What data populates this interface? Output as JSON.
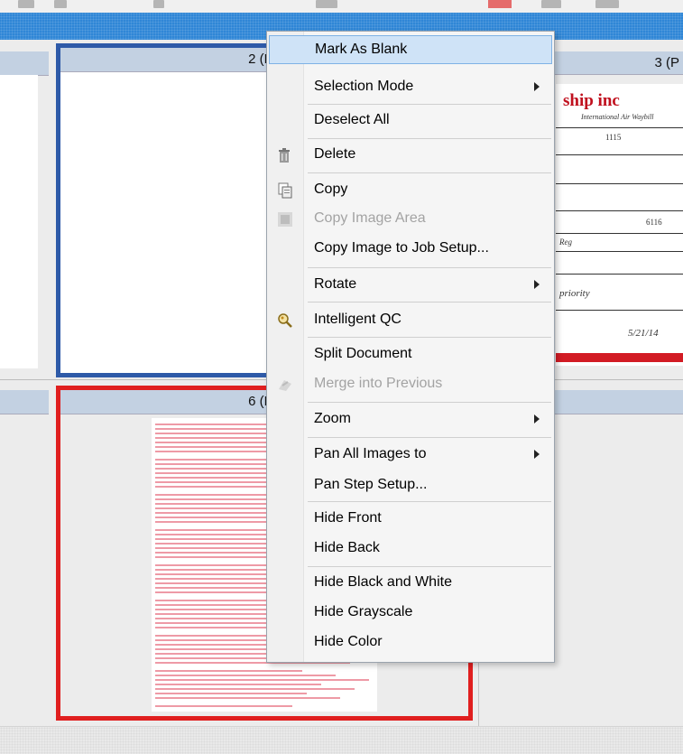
{
  "cells": {
    "page2_label": "2 (Pg",
    "page3_label": "3 (P",
    "page6_label": "6 (Pg"
  },
  "doc3": {
    "brand": "ship inc",
    "tagline": "International Air Waybill",
    "field1": "1115",
    "field2": "6116",
    "field3": "Reg",
    "scrib1": "priority",
    "scrib2": "5/21/14"
  },
  "menu": {
    "items": [
      {
        "label": "Mark As Blank",
        "icon": "",
        "enabled": true,
        "submenu": false
      },
      {
        "label": "Selection Mode",
        "icon": "",
        "enabled": true,
        "submenu": true
      },
      {
        "label": "Deselect All",
        "icon": "",
        "enabled": true,
        "submenu": false
      },
      {
        "label": "Delete",
        "icon": "trash-icon",
        "enabled": true,
        "submenu": false
      },
      {
        "label": "Copy",
        "icon": "copy-icon",
        "enabled": true,
        "submenu": false
      },
      {
        "label": "Copy Image Area",
        "icon": "copy-area-icon",
        "enabled": false,
        "submenu": false
      },
      {
        "label": "Copy Image to Job Setup...",
        "icon": "",
        "enabled": true,
        "submenu": false
      },
      {
        "label": "Rotate",
        "icon": "",
        "enabled": true,
        "submenu": true
      },
      {
        "label": "Intelligent QC",
        "icon": "magnifier-icon",
        "enabled": true,
        "submenu": false
      },
      {
        "label": "Split Document",
        "icon": "",
        "enabled": true,
        "submenu": false
      },
      {
        "label": "Merge into Previous",
        "icon": "merge-icon",
        "enabled": false,
        "submenu": false
      },
      {
        "label": "Zoom",
        "icon": "",
        "enabled": true,
        "submenu": true
      },
      {
        "label": "Pan All Images to",
        "icon": "",
        "enabled": true,
        "submenu": true
      },
      {
        "label": "Pan Step Setup...",
        "icon": "",
        "enabled": true,
        "submenu": false
      },
      {
        "label": "Hide Front",
        "icon": "",
        "enabled": true,
        "submenu": false
      },
      {
        "label": "Hide Back",
        "icon": "",
        "enabled": true,
        "submenu": false
      },
      {
        "label": "Hide Black and White",
        "icon": "",
        "enabled": true,
        "submenu": false
      },
      {
        "label": "Hide Grayscale",
        "icon": "",
        "enabled": true,
        "submenu": false
      },
      {
        "label": "Hide Color",
        "icon": "",
        "enabled": true,
        "submenu": false
      }
    ]
  },
  "colors": {
    "selection_blue": "#2e5aa8",
    "selection_red": "#e01f1f",
    "menu_hover": "#cfe3f7",
    "band_blue": "#2f86d6"
  }
}
